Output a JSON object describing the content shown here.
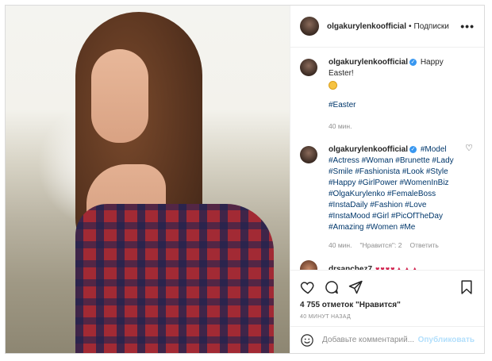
{
  "post": {
    "username": "olgakurylenkoofficial",
    "separator": "•",
    "follow_label": "Подписки",
    "more_label": "•••"
  },
  "caption": {
    "username": "olgakurylenkoofficial",
    "text": "Happy Easter!",
    "tag": "#Easter",
    "time": "40 мин."
  },
  "comment": {
    "username": "olgakurylenkoofficial",
    "tags": "#Model #Actress #Woman #Brunette #Lady #Smile #Fashionista #Look #Style #Happy #GirlPower #WomenInBiz #OlgaKurylenko #FemaleBoss #InstaDaily #Fashion #Love #InstaMood #Girl #PicOfTheDay #Amazing #Women #Me",
    "time": "40 мин.",
    "likes": "\"Нравится\": 2",
    "reply": "Ответить"
  },
  "partial_comment": {
    "username": "drsanchez7",
    "emoji": "♥♥♥♥▲▲▲"
  },
  "likes_text": "4 755 отметок \"Нравится\"",
  "time_ago": "40 МИНУТ НАЗАД",
  "add_comment": {
    "placeholder": "Добавьте комментарий...",
    "publish_label": "Опубликовать"
  },
  "icons": {
    "verified": "verified-badge-icon",
    "heart": "heart-icon",
    "comment": "comment-icon",
    "share": "share-icon",
    "save": "bookmark-icon",
    "emoji": "smile-icon"
  },
  "colors": {
    "link": "#00376b",
    "verified": "#3897f0",
    "publish_disabled": "#b2dffc",
    "muted": "#8e8e8e"
  }
}
